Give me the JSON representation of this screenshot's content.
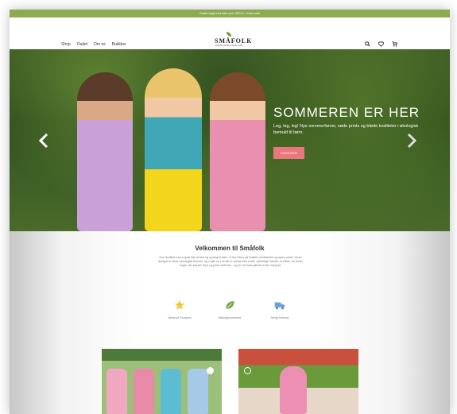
{
  "topbar": {
    "text": "Gratis fragt ved køb over 300 kr. i Danmark"
  },
  "nav": {
    "items": [
      "Shop",
      "Outlet",
      "Om os",
      "Butikker"
    ]
  },
  "logo": {
    "word": "SMÅFOLK",
    "tag": "DANISH DESIGN SINCE 1998"
  },
  "hero": {
    "title": "SOMMEREN ER HER",
    "subtitle": "Leg, leg, leg! Nye sommerfarver, søde prints og bløde kvaliteter i økologisk bomuld til børn.",
    "button": "SHOP HER"
  },
  "welcome": {
    "title": "Velkommen til Småfolk",
    "body": "Hos Småfolk kan vi godt lide at lave tøj og ting til børn. Vi har fokus på kvalitet, holdbarhed og sjove prints. Vores designs er lavet i økologisk bomuld, og vi går op i, at det er produceret under ordentlige forhold. Vi håber, du finder noget, der passer til jer og jeres små folk – og at I vil have glæde af det i lang tid."
  },
  "usps": [
    {
      "label": "Bedst på Trustpilot",
      "icon": "star-icon",
      "color": "#f0c73a"
    },
    {
      "label": "Økologisk bomuld",
      "icon": "leaf-icon",
      "color": "#7aa84a"
    },
    {
      "label": "Hurtig levering",
      "icon": "truck-icon",
      "color": "#6aa0d8"
    }
  ],
  "colors": {
    "accent": "#8aab4f",
    "button": "#e9787d"
  }
}
